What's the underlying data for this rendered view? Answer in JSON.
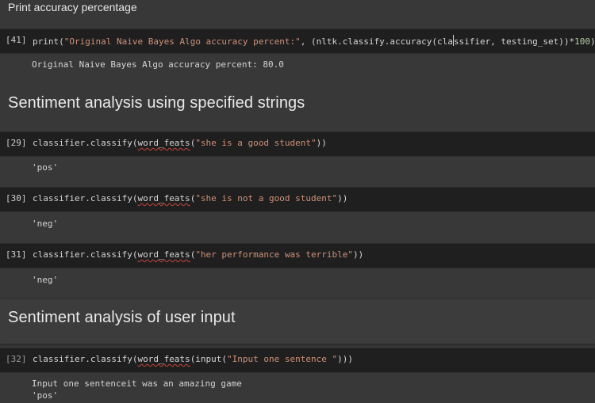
{
  "sections": {
    "print_accuracy": "Print accuracy percentage",
    "specified_strings": "Sentiment analysis using specified strings",
    "user_input": "Sentiment analysis of user input"
  },
  "cells": [
    {
      "prompt": "[41]",
      "code": {
        "p1": "print(",
        "s1": "\"Original Naive Bayes Algo accuracy percent:\"",
        "p2": ", (nltk.classify.accuracy(cla",
        "p3": "ssifier, testing_set))*",
        "n1": "100",
        "p4": ")"
      },
      "output": "Original Naive Bayes Algo accuracy percent: 80.0"
    },
    {
      "prompt": "[29]",
      "code": {
        "p1": "classifier.classify(",
        "fn": "word_feats",
        "p2": "(",
        "s1": "\"she is a good student\"",
        "p3": "))"
      },
      "output": "'pos'"
    },
    {
      "prompt": "[30]",
      "code": {
        "p1": "classifier.classify(",
        "fn": "word_feats",
        "p2": "(",
        "s1": "\"she is not a good student\"",
        "p3": "))"
      },
      "output": "'neg'"
    },
    {
      "prompt": "[31]",
      "code": {
        "p1": "classifier.classify(",
        "fn": "word_feats",
        "p2": "(",
        "s1": "\"her performance was terrible\"",
        "p3": "))"
      },
      "output": "'neg'"
    },
    {
      "prompt": "[32]",
      "code": {
        "p1": "classifier.classify(",
        "fn": "word_feats",
        "p2": "(input(",
        "s1": "\"Input one sentence \"",
        "p3": ")))"
      },
      "output_line1": "Input one sentenceit was an amazing game",
      "output_line2": "'pos'"
    }
  ],
  "colors": {
    "background": "#383838",
    "code_background": "#1f1f1f",
    "string": "#ce9178",
    "number": "#b5cea8",
    "squiggle": "#c5453b"
  }
}
